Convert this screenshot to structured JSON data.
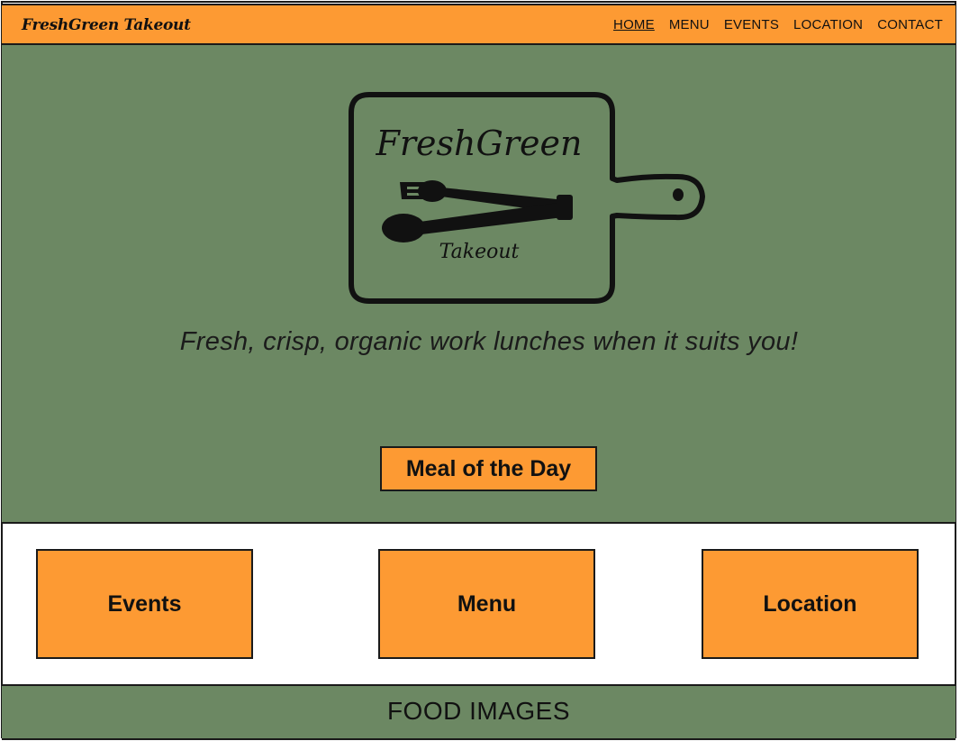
{
  "colors": {
    "accent": "#fd9a33",
    "hero": "#6c8863",
    "outline": "#1a1a1a"
  },
  "header": {
    "brand": "FreshGreen Takeout",
    "nav": {
      "home": "HOME",
      "menu": "MENU",
      "events": "EVENTS",
      "location": "LOCATION",
      "contact": "CONTACT"
    }
  },
  "hero": {
    "logo": {
      "title": "FreshGreen",
      "subtitle": "Takeout",
      "icon": "cutting-board-fork-spoon-icon"
    },
    "tagline": "Fresh, crisp, organic work lunches when it suits you!",
    "button": "Meal of the Day"
  },
  "tiles": {
    "events": "Events",
    "menu": "Menu",
    "location": "Location"
  },
  "footer": {
    "banner": "FOOD IMAGES"
  }
}
